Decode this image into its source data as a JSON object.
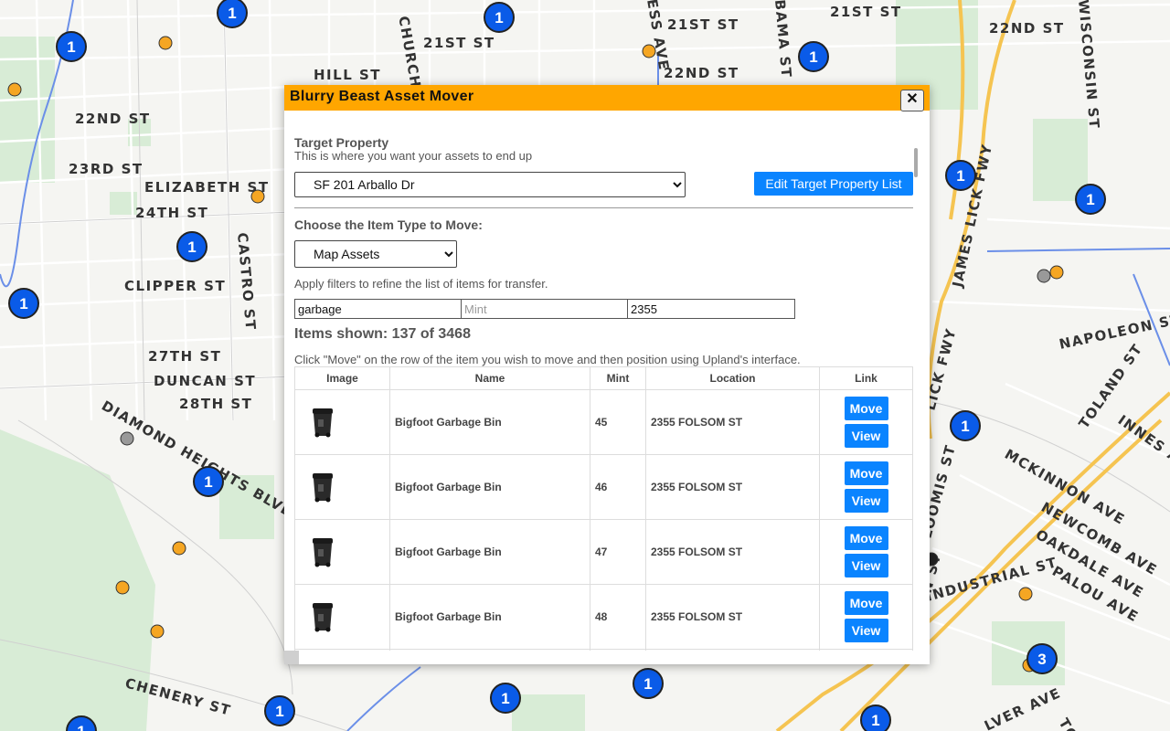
{
  "map": {
    "streets": [
      "CHURCH ST",
      "21ST ST",
      "21ST ST",
      "21ST ST",
      "22ND ST",
      "22ND ST",
      "22ND ST",
      "HILL ST",
      "23RD ST",
      "ELIZABETH ST",
      "24TH ST",
      "CASTRO ST",
      "CLIPPER ST",
      "27TH ST",
      "DUNCAN ST",
      "28TH ST",
      "DIAMOND HEIGHTS BLVD",
      "CHENERY ST",
      "ESS AVE",
      "BAMA ST",
      "WISCONSIN ST",
      "JAMES LICK FWY",
      "NAPOLEON ST",
      "TOLAND ST",
      "INNES AV",
      "MCKINNON AVE",
      "NEWCOMB AVE",
      "OAKDALE AVE",
      "PALOU AVE",
      "INDUSTRIAL ST",
      "LICK FWY",
      "LOOMIS ST",
      "N ST",
      "LVER AVE",
      "TO"
    ],
    "markers": [
      "1",
      "1",
      "1",
      "1",
      "1",
      "1",
      "1",
      "1",
      "1",
      "1",
      "1",
      "1",
      "1",
      "1",
      "1",
      "3",
      "1"
    ]
  },
  "dialog": {
    "title": "Blurry Beast Asset Mover",
    "close_label": "✕",
    "target_heading": "Target Property",
    "target_sub": "This is where you want your assets to end up",
    "target_selected": "SF 201 Arballo Dr",
    "edit_button": "Edit Target Property List",
    "item_type_label": "Choose the Item Type to Move:",
    "item_type_selected": "Map Assets",
    "filter_hint": "Apply filters to refine the list of items for transfer.",
    "filters": {
      "name_value": "garbage",
      "mint_placeholder": "Mint",
      "location_value": "2355"
    },
    "items_shown": "Items shown: 137 of 3468",
    "instructions": "Click \"Move\" on the row of the item you wish to move and then position using Upland's interface.",
    "table": {
      "headers": [
        "Image",
        "Name",
        "Mint",
        "Location",
        "Link"
      ],
      "rows": [
        {
          "name": "Bigfoot Garbage Bin",
          "mint": "45",
          "location": "2355 FOLSOM ST",
          "move": "Move",
          "view": "View"
        },
        {
          "name": "Bigfoot Garbage Bin",
          "mint": "46",
          "location": "2355 FOLSOM ST",
          "move": "Move",
          "view": "View"
        },
        {
          "name": "Bigfoot Garbage Bin",
          "mint": "47",
          "location": "2355 FOLSOM ST",
          "move": "Move",
          "view": "View"
        },
        {
          "name": "Bigfoot Garbage Bin",
          "mint": "48",
          "location": "2355 FOLSOM ST",
          "move": "Move",
          "view": "View"
        }
      ]
    }
  },
  "colors": {
    "titlebar": "#ffa600",
    "button": "#0a84ff",
    "marker_blue": "#0a5be8",
    "marker_orange": "#f5a623",
    "freeway": "#f5c451"
  }
}
